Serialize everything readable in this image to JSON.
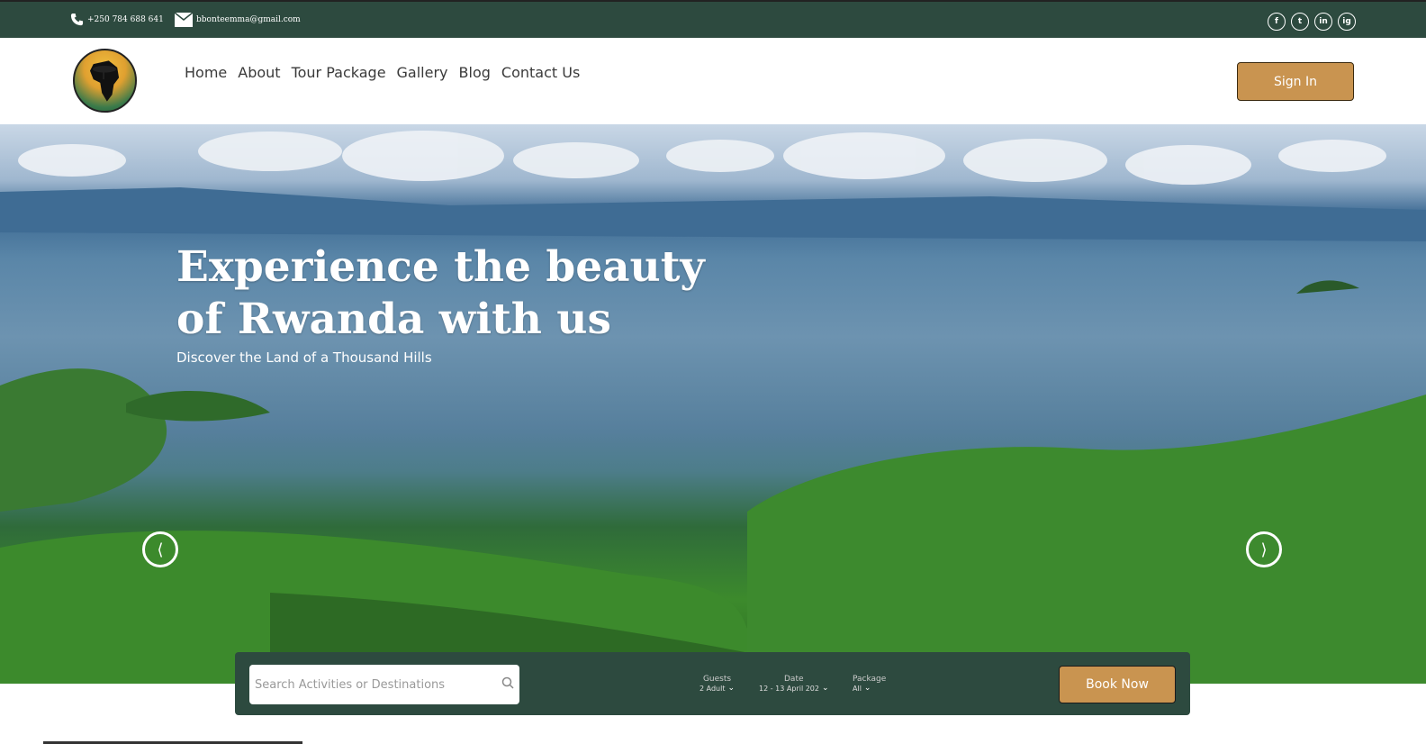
{
  "topbar": {
    "phone": "+250 784 688 641",
    "email": "bbonteemma@gmail.com",
    "socials": [
      "f",
      "t",
      "in",
      "ig"
    ]
  },
  "nav": {
    "items": [
      "Home",
      "About",
      "Tour Package",
      "Gallery",
      "Blog",
      "Contact Us"
    ],
    "sign_in": "Sign In"
  },
  "hero": {
    "title_line1": "Experience the beauty",
    "title_line2": "of Rwanda with us",
    "subtitle": "Discover the Land of a Thousand Hills",
    "prev": "⟨",
    "next": "⟩"
  },
  "booking": {
    "search_placeholder": "Search Activities or Destinations",
    "guests_label": "Guests",
    "guests_value": "2 Adult",
    "date_label": "Date",
    "date_value": "12 - 13 April 202",
    "package_label": "Package",
    "package_value": "All",
    "book_now": "Book Now"
  },
  "colors": {
    "brand_dark_green": "#2d4a3f",
    "accent_gold": "#c99450"
  }
}
